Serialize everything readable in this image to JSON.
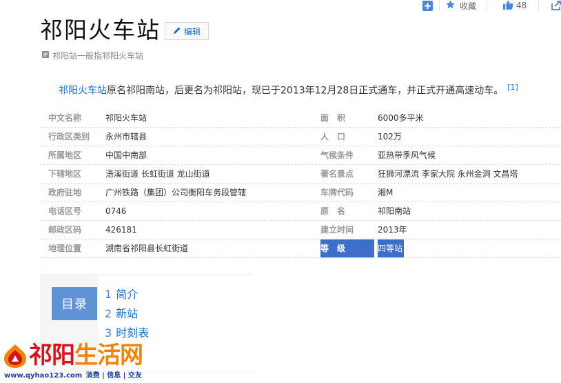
{
  "toolbar": {
    "favorite_label": "收藏",
    "like_count": "48"
  },
  "title": "祁阳火车站",
  "edit_label": "编辑",
  "subtitle": "祁阳站一般指祁阳火车站",
  "summary": {
    "link": "祁阳火车站",
    "text": "原名祁阳南站，后更名为祁阳站，现已于2013年12月28日正式通车，并正式开通高速动车。",
    "ref": "[1]"
  },
  "info": [
    {
      "k1": "中文名称",
      "v1": "祁阳火车站",
      "k2": "面　积",
      "v2": "6000多平米"
    },
    {
      "k1": "行政区类别",
      "v1": "永州市辖县",
      "k2": "人　口",
      "v2": "102万"
    },
    {
      "k1": "所属地区",
      "v1": "中国中南部",
      "k2": "气候条件",
      "v2": "亚热带季风气候"
    },
    {
      "k1": "下辖地区",
      "v1": "浯溪街道 长虹街道 龙山街道",
      "k2": "著名景点",
      "v2": "狂狮河漂流  李家大院 永州金洞  文昌塔"
    },
    {
      "k1": "政府驻地",
      "v1": "广州铁路（集团）公司衡阳车务段管辖",
      "k2": "车牌代码",
      "v2": "湘M"
    },
    {
      "k1": "电话区号",
      "v1": "0746",
      "k2": "原　名",
      "v2": " 祁阳南站"
    },
    {
      "k1": "邮政区码",
      "v1": "426181",
      "k2": "建立时间",
      "v2": "2013年"
    },
    {
      "k1": "地理位置",
      "v1": "湖南省祁阳县长虹街道",
      "k2": "等　级",
      "v2": "四等站"
    }
  ],
  "catalog": {
    "label": "目录",
    "items": [
      {
        "num": "1",
        "label": "简介"
      },
      {
        "num": "2",
        "label": "新站"
      },
      {
        "num": "3",
        "label": "时刻表"
      }
    ]
  },
  "watermark": {
    "text_red": "祁阳",
    "text_orange": "生活网",
    "url": "www.qyhao123.com",
    "tags": "消费 | 信息 | 交友"
  },
  "colors": {
    "link": "#136ec2",
    "highlight": "#3d6fc8",
    "catalog_label_bg": "#5f93d5",
    "watermark_red": "#d6121d",
    "watermark_orange": "#f08300"
  }
}
